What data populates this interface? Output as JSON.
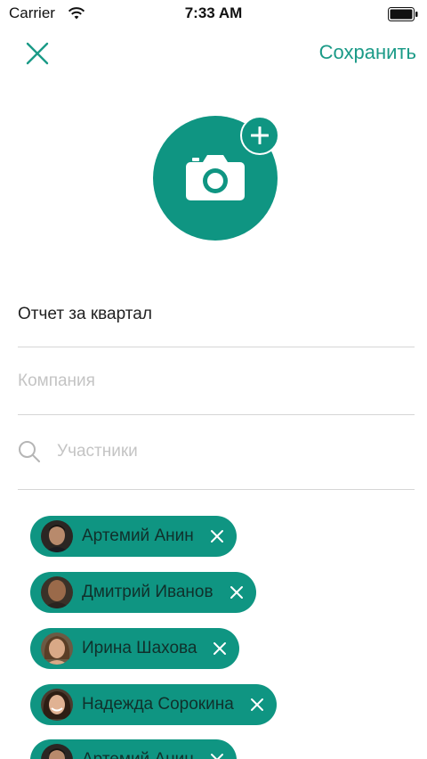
{
  "status_bar": {
    "carrier": "Carrier",
    "time": "7:33 AM"
  },
  "header": {
    "save_label": "Сохранить"
  },
  "form": {
    "report_title": "Отчет за квартал",
    "company_placeholder": "Компания",
    "participants_placeholder": "Участники"
  },
  "participants": [
    {
      "name": "Артемий Анин"
    },
    {
      "name": "Дмитрий Иванов"
    },
    {
      "name": "Ирина Шахова"
    },
    {
      "name": "Надежда Сорокина"
    },
    {
      "name": "Артемий Анин"
    }
  ],
  "colors": {
    "accent": "#0f9582",
    "accent_text": "#1a9a87",
    "divider": "#d6d6d6"
  }
}
